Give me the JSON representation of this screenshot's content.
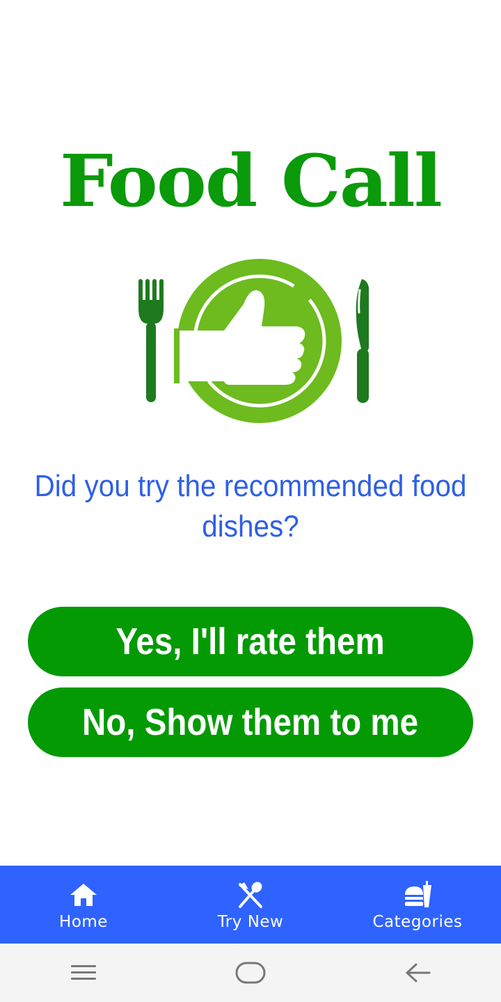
{
  "app": {
    "title": "Food Call"
  },
  "prompt": {
    "question": "Did you try the recommended food dishes?"
  },
  "actions": {
    "yes_label": "Yes, I'll rate them",
    "no_label": "No, Show them to me"
  },
  "bottom_nav": {
    "items": [
      {
        "label": "Home",
        "icon": "home-icon"
      },
      {
        "label": "Try New",
        "icon": "fork-spoon-icon"
      },
      {
        "label": "Categories",
        "icon": "fastfood-icon"
      }
    ]
  },
  "system_nav": {
    "items": [
      {
        "icon": "menu-icon"
      },
      {
        "icon": "home-pill-icon"
      },
      {
        "icon": "back-arrow-icon"
      }
    ]
  },
  "colors": {
    "title_green": "#0a9a0a",
    "button_green": "#049a04",
    "question_blue": "#2f5fe8",
    "nav_blue": "#2f63ff",
    "system_bar": "#f4f4f4"
  }
}
